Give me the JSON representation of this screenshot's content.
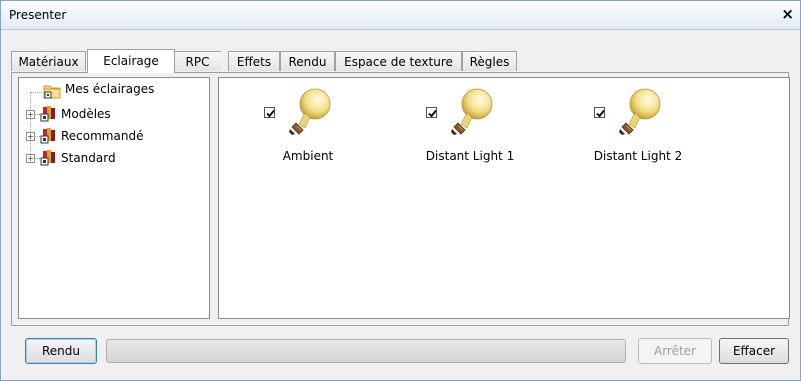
{
  "window": {
    "title": "Presenter",
    "close_glyph": "×"
  },
  "tabs": [
    {
      "label": "Matériaux"
    },
    {
      "label": "Eclairage",
      "active": true
    },
    {
      "label": "RPC"
    },
    {
      "label": "Effets"
    },
    {
      "label": "Rendu"
    },
    {
      "label": "Espace de texture"
    },
    {
      "label": "Règles"
    }
  ],
  "tree": {
    "items": [
      {
        "label": "Mes éclairages",
        "icon": "folder-icon",
        "expandable": false
      },
      {
        "label": "Modèles",
        "icon": "library-books-icon",
        "expandable": true
      },
      {
        "label": "Recommandé",
        "icon": "library-books-icon",
        "expandable": true
      },
      {
        "label": "Standard",
        "icon": "library-books-icon",
        "expandable": true
      }
    ]
  },
  "lights": [
    {
      "label": "Ambient",
      "checked": true,
      "icon": "light-bulb-icon"
    },
    {
      "label": "Distant Light 1",
      "checked": true,
      "icon": "light-bulb-icon"
    },
    {
      "label": "Distant Light 2",
      "checked": true,
      "icon": "light-bulb-icon"
    }
  ],
  "footer": {
    "render_label": "Rendu",
    "stop_label": "Arrêter",
    "clear_label": "Effacer",
    "progress": 0
  },
  "colors": {
    "accent_border": "#3c7fb1",
    "titlebar": "#e3ebf5"
  }
}
